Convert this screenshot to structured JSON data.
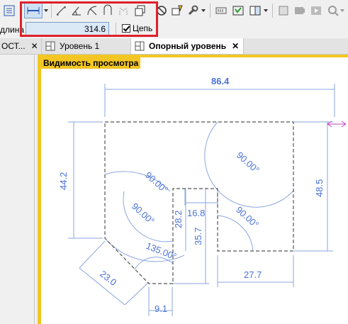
{
  "toolbar": {
    "items": [
      "dimension-mode-icon",
      "aligned-dimension-icon",
      "linear-dimension-icon",
      "angular-dimension-icon",
      "radial-dimension-icon",
      "arc-length-icon",
      "spot-dimension-icon",
      "elevation-icon",
      "restrict-icon",
      "lock-icon",
      "wrench-icon",
      "plan-region-icon",
      "detail-component-icon",
      "repeat-component-icon",
      "tag-icon",
      "film-icon",
      "play-icon",
      "zoom-icon"
    ]
  },
  "options": {
    "length_label": "длина",
    "length_value": "314.6",
    "chain_label": "Цепь",
    "chain_checked": true
  },
  "tabs": [
    {
      "label": "ОСТ...",
      "close": "✕"
    },
    {
      "label": "Уровень 1",
      "close": ""
    },
    {
      "label": "Опорный уровень",
      "close": "✕"
    }
  ],
  "view": {
    "title": "Видимость просмотра"
  },
  "dimensions": {
    "top": "86.4",
    "left": "44.2",
    "right": "48.5",
    "width_small": "16.8",
    "height_a": "28.2",
    "height_b": "35.7",
    "bottom_right": "27.7",
    "diag": "23.0",
    "bottom_small": "9.1",
    "angle1": "90.00°",
    "angle2": "90.00°",
    "angle3": "90.00°",
    "angle4": "90.00°",
    "angle5": "135.00°"
  },
  "colors": {
    "highlight": "#e0202a",
    "dimension": "#4a72d8",
    "view_border": "#f3c623"
  }
}
